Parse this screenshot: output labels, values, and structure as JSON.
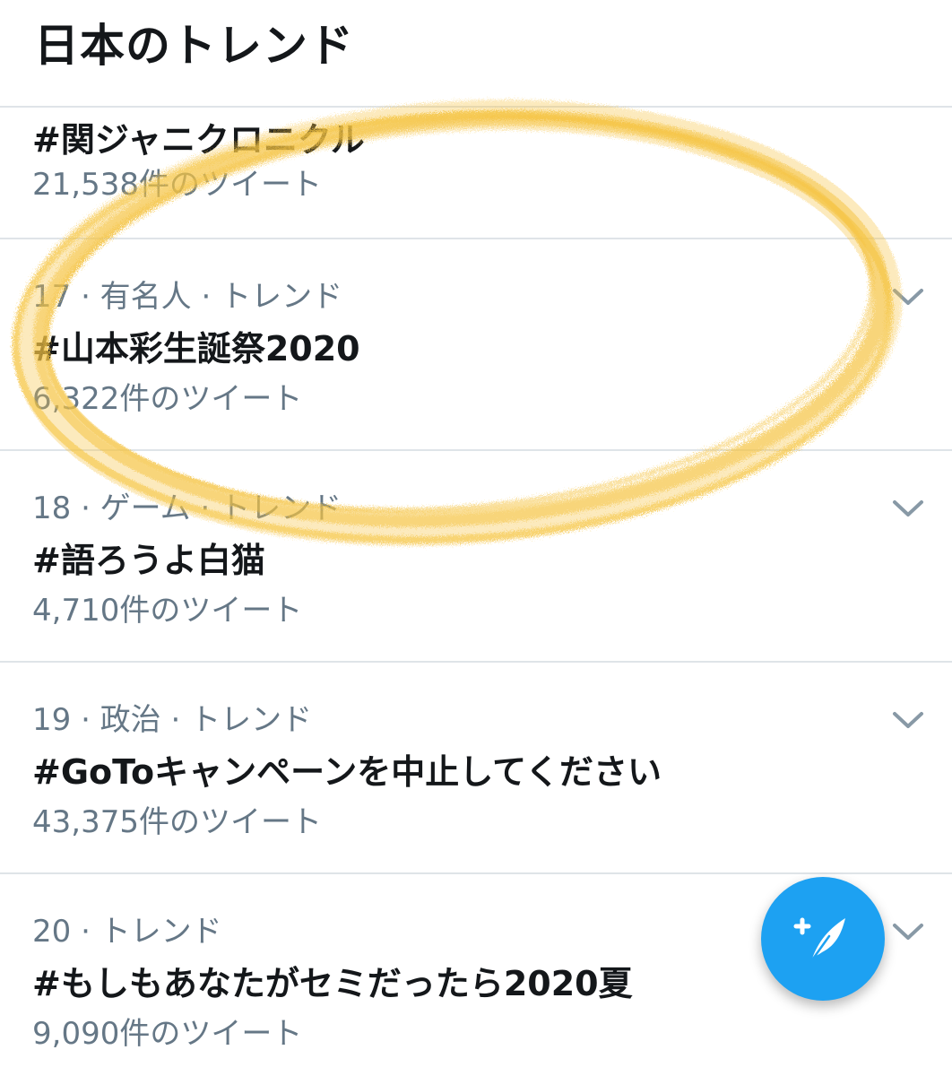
{
  "header": {
    "title": "日本のトレンド"
  },
  "trends": [
    {
      "meta": "",
      "name": "#関ジャニクロニクル",
      "count": "21,538件のツイート"
    },
    {
      "meta": "17 · 有名人 · トレンド",
      "name": "#山本彩生誕祭2020",
      "count": "6,322件のツイート"
    },
    {
      "meta": "18 · ゲーム · トレンド",
      "name": "#語ろうよ白猫",
      "count": "4,710件のツイート"
    },
    {
      "meta": "19 · 政治 · トレンド",
      "name": "#GoToキャンペーンを中止してください",
      "count": "43,375件のツイート"
    },
    {
      "meta": "20 · トレンド",
      "name": "#もしもあなたがセミだったら2020夏",
      "count": "9,090件のツイート"
    }
  ],
  "fab": {
    "icon": "compose-tweet-icon"
  },
  "colors": {
    "accent": "#1da1f2",
    "text_primary": "#14171a",
    "text_secondary": "#657786",
    "divider": "#dfe4e8",
    "highlight_scribble": "#f5c443"
  }
}
